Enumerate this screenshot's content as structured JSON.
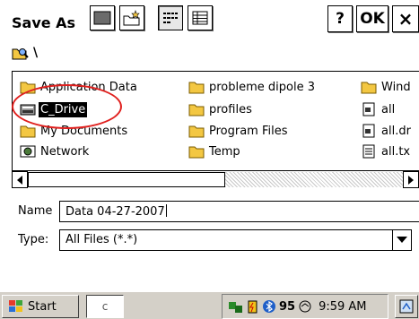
{
  "dialog": {
    "title": "Save As",
    "help_label": "?",
    "ok_label": "OK",
    "close_label": "×"
  },
  "path": {
    "text": "\\"
  },
  "files": [
    {
      "name": "Application Data",
      "type": "folder"
    },
    {
      "name": "C_Drive",
      "type": "drive",
      "selected": true
    },
    {
      "name": "My Documents",
      "type": "folder"
    },
    {
      "name": "Network",
      "type": "network"
    },
    {
      "name": "probleme dipole 3",
      "type": "folder"
    },
    {
      "name": "profiles",
      "type": "folder"
    },
    {
      "name": "Program Files",
      "type": "folder"
    },
    {
      "name": "Temp",
      "type": "folder"
    },
    {
      "name": "Wind",
      "type": "folder"
    },
    {
      "name": "all",
      "type": "shortcut"
    },
    {
      "name": "all.dr",
      "type": "shortcut"
    },
    {
      "name": "all.tx",
      "type": "textfile"
    }
  ],
  "form": {
    "name_label": "Name",
    "name_value": "Data 04-27-2007",
    "type_label": "Type:",
    "type_value": "All Files (*.*)"
  },
  "taskbar": {
    "start_label": "Start",
    "task_text": "c",
    "clock": "9:59 AM",
    "tray_text": "95"
  },
  "colors": {
    "annotation": "#e0201e",
    "folder": "#f3c742",
    "taskbar": "#d4d0c8"
  }
}
